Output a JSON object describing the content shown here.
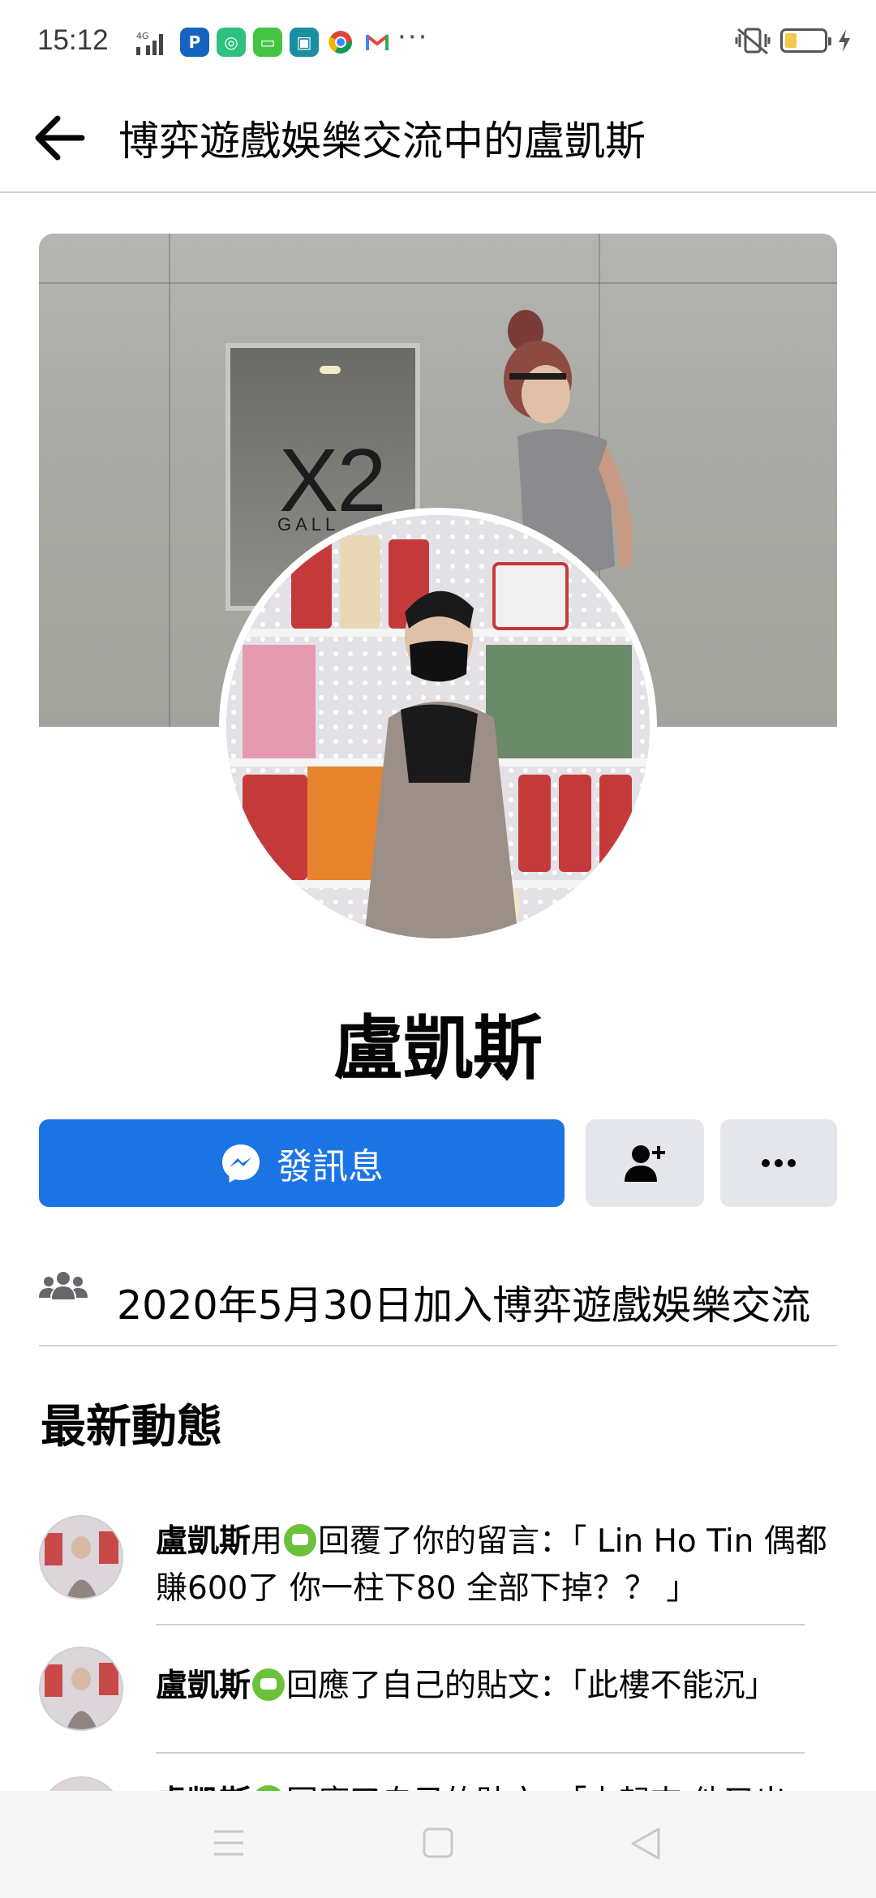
{
  "status_bar": {
    "time": "15:12",
    "network": "4G",
    "more": "···",
    "battery_level": 0.3
  },
  "header": {
    "title": "博弈遊戲娛樂交流中的盧凱斯"
  },
  "cover": {
    "sign_text": "X2",
    "sign_sub": "GALL"
  },
  "profile": {
    "name": "盧凱斯",
    "message_button": "發訊息",
    "joined_text": "2020年5月30日加入博弈遊戲娛樂交流"
  },
  "activity": {
    "title": "最新動態",
    "items": [
      {
        "name": "盧凱斯",
        "pre": "用",
        "text": "回覆了你的留言：「 Lin Ho Tin 偶都賺600了 你一柱下80 全部下掉？？ 」"
      },
      {
        "name": "盧凱斯",
        "pre": "",
        "text": "回應了自己的貼文：「此樓不能沉」"
      },
      {
        "name": "盧凱斯",
        "pre": "",
        "text": "回應了自己的貼文：「占起來 他又出"
      }
    ]
  },
  "colors": {
    "primary": "#1b74e4",
    "secondary_button": "#e4e6eb",
    "text": "#050505"
  },
  "icons": {
    "back": "arrow-left-icon",
    "messenger": "messenger-icon",
    "add_friend": "add-friend-icon",
    "more": "more-icon",
    "group": "group-icon"
  }
}
